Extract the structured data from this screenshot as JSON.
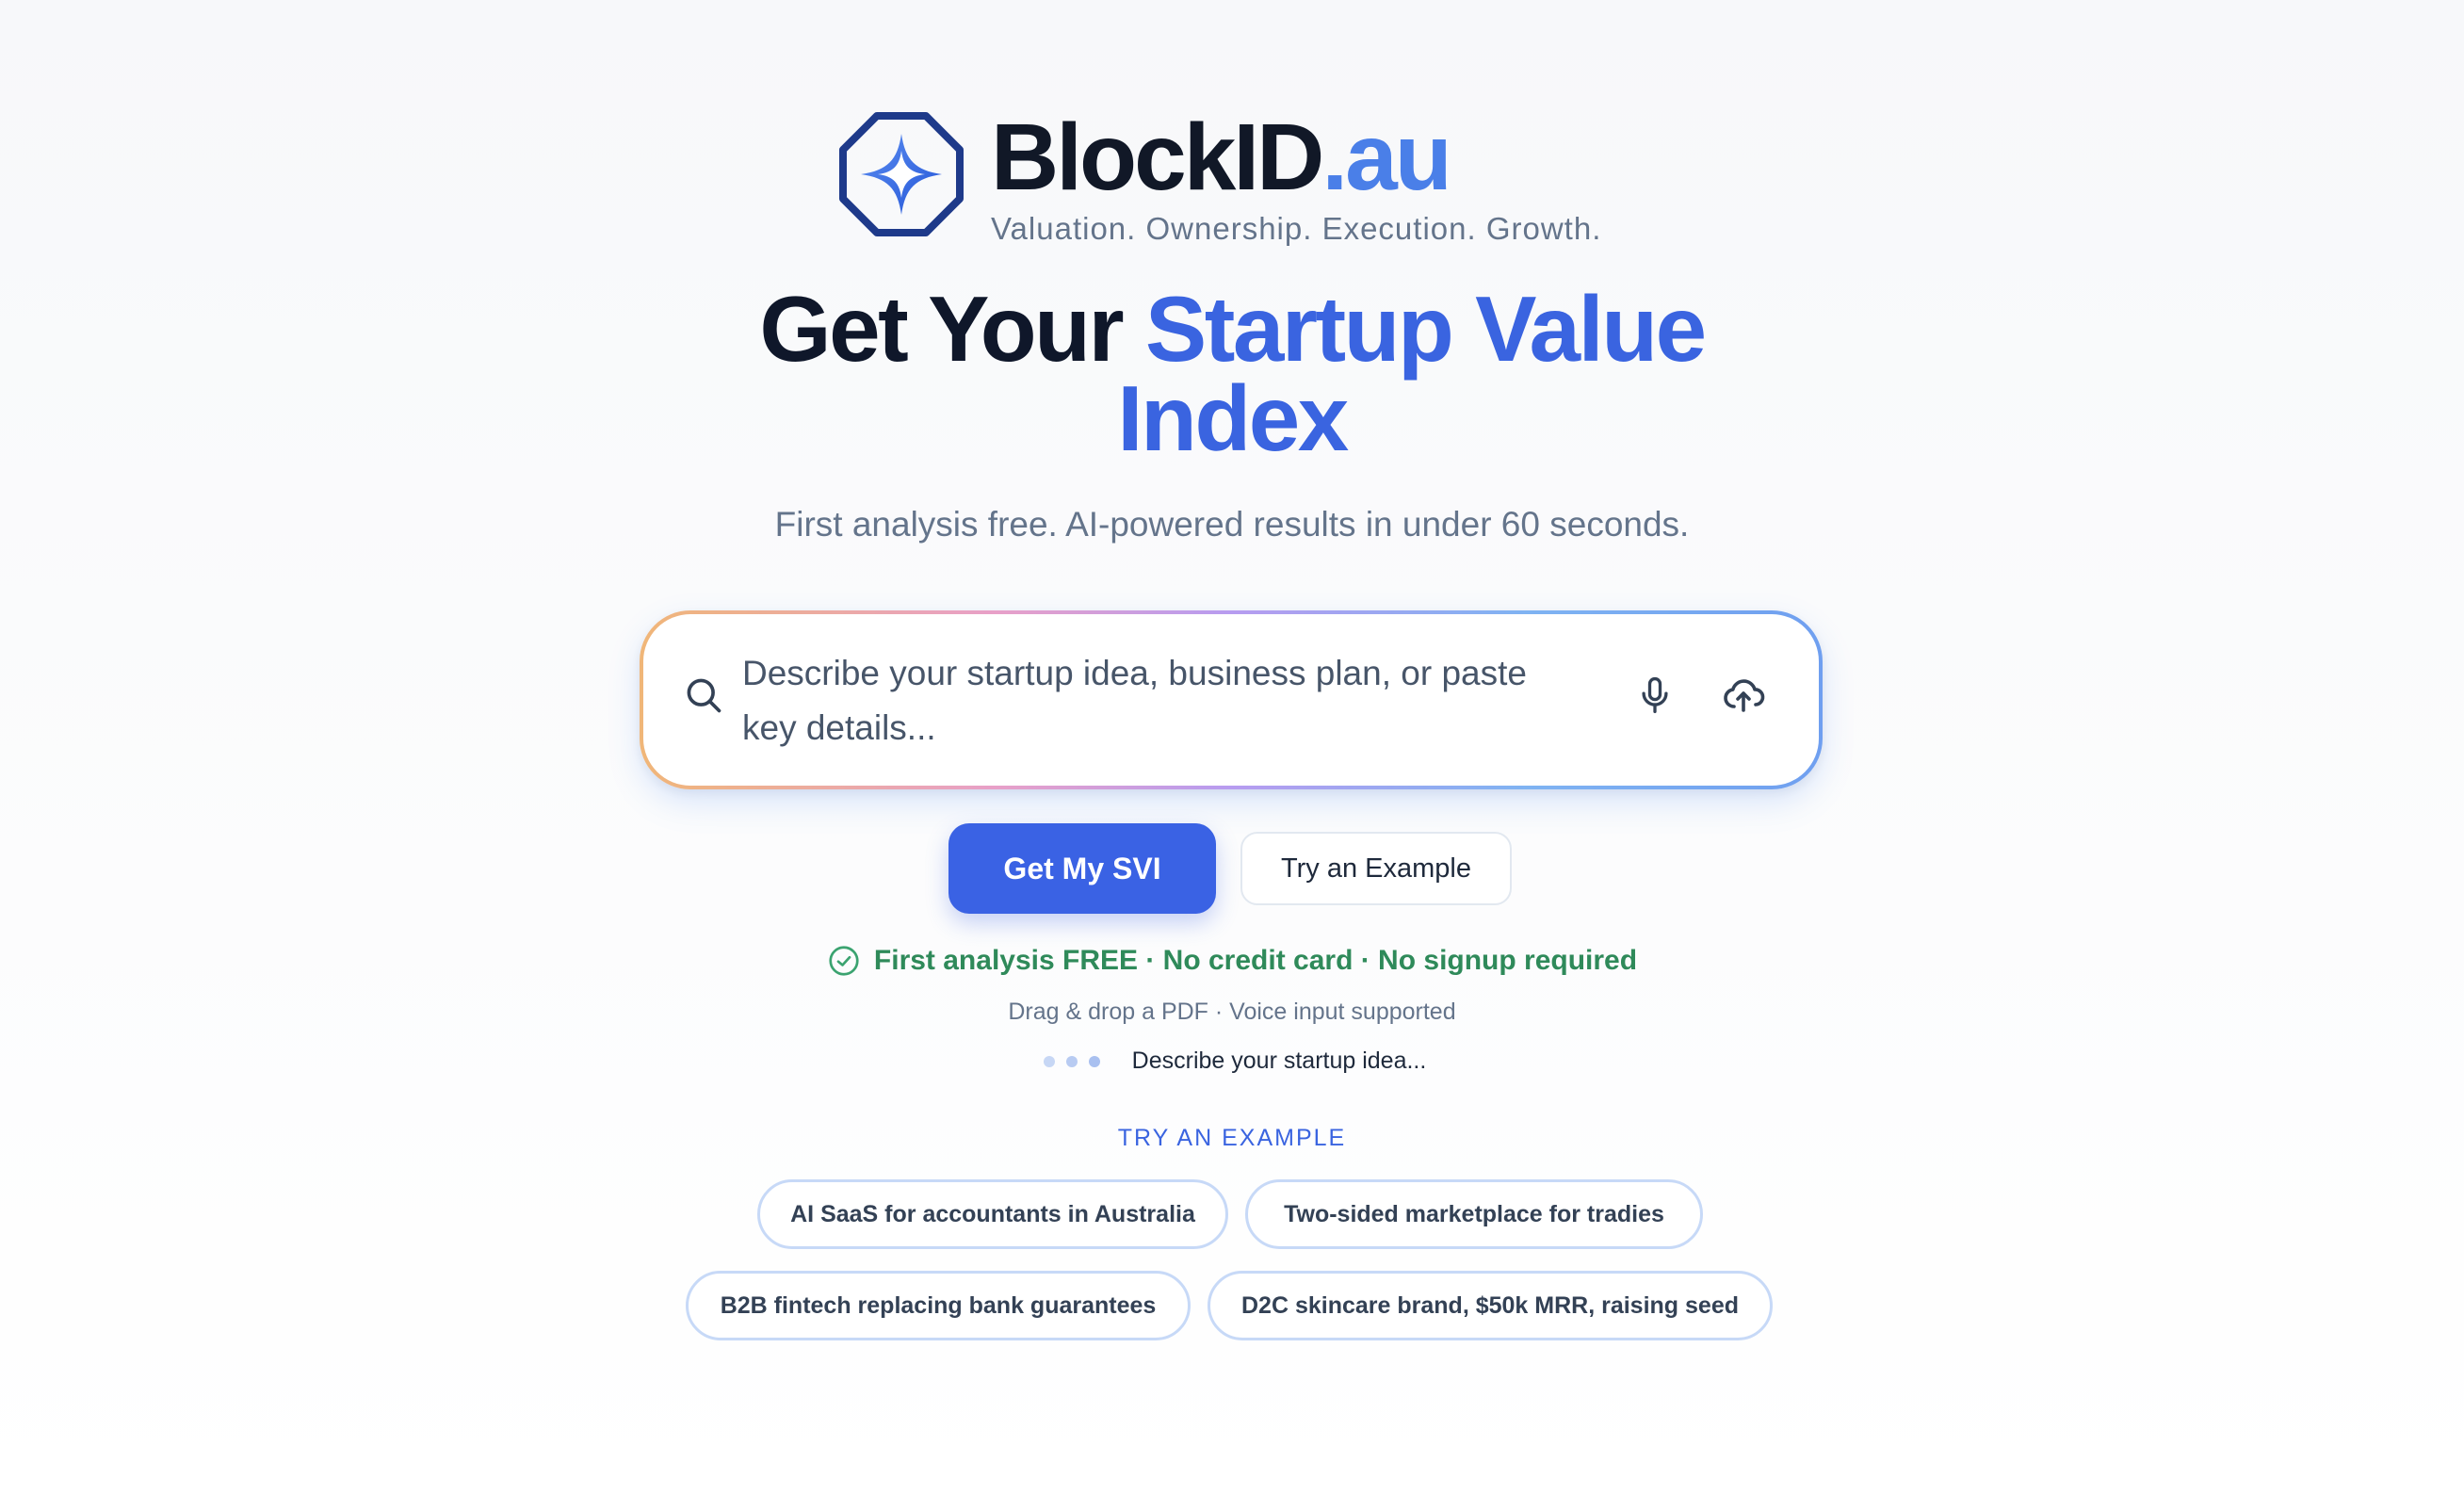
{
  "brand": {
    "name": "BlockID",
    "tld": ".au",
    "tagline": "Valuation. Ownership. Execution. Growth.",
    "logo_icon": "sparkle-octagon-icon",
    "colors": {
      "dark": "#111827",
      "accent": "#4a7fe8",
      "logo_border": "#1e3a8a"
    }
  },
  "hero": {
    "title_part1": "Get Your ",
    "title_part2": "Startup Value",
    "title_part3": "Index",
    "subtitle": "First analysis free. AI-powered results in under 60 seconds."
  },
  "search": {
    "placeholder": "Describe your startup idea, business plan, or paste key details...",
    "icons": {
      "search": "search-icon",
      "mic": "microphone-icon",
      "upload": "cloud-upload-icon"
    }
  },
  "actions": {
    "primary_label": "Get My SVI",
    "secondary_label": "Try an Example",
    "primary_color": "#3a62e4"
  },
  "notes": {
    "free_line": "First analysis FREE · No credit card · No signup required",
    "free_color": "#2f8a5a",
    "drag_line": "Drag & drop a PDF · Voice input supported",
    "typing_text": "Describe your startup idea..."
  },
  "examples": {
    "label": "TRY AN EXAMPLE",
    "chips": [
      "AI SaaS for accountants in Australia",
      "Two-sided marketplace for tradies",
      "B2B fintech replacing bank guarantees",
      "D2C skincare brand, $50k MRR, raising seed"
    ]
  }
}
